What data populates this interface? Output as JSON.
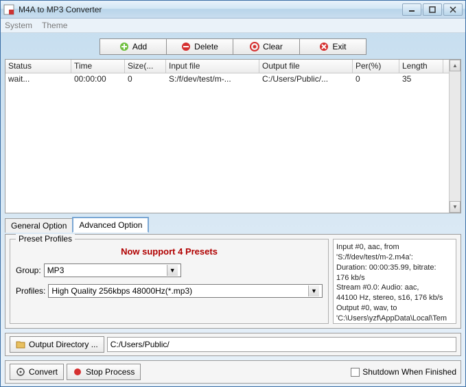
{
  "window": {
    "title": "M4A to MP3 Converter"
  },
  "menu": {
    "system": "System",
    "theme": "Theme"
  },
  "toolbar": {
    "add": "Add",
    "delete": "Delete",
    "clear": "Clear",
    "exit": "Exit"
  },
  "table": {
    "headers": {
      "status": "Status",
      "time": "Time",
      "size": "Size(...",
      "input": "Input file",
      "output": "Output file",
      "per": "Per(%)",
      "length": "Length"
    },
    "rows": [
      {
        "status": "wait...",
        "time": "00:00:00",
        "size": "0",
        "input": "S:/f/dev/test/m-...",
        "output": "C:/Users/Public/...",
        "per": "0",
        "length": "35"
      }
    ]
  },
  "tabs": {
    "general": "General Option",
    "advanced": "Advanced Option"
  },
  "presets": {
    "legend": "Preset Profiles",
    "message": "Now support 4 Presets",
    "group_label": "Group:",
    "group_value": "MP3",
    "profiles_label": "Profiles:",
    "profiles_value": "High Quality 256kbps 48000Hz(*.mp3)"
  },
  "info": {
    "l1": "Input #0, aac, from",
    "l2": "'S:/f/dev/test/m-2.m4a':",
    "l3": "  Duration: 00:00:35.99, bitrate:",
    "l4": "176 kb/s",
    "l5": "    Stream #0.0: Audio: aac,",
    "l6": "44100 Hz, stereo, s16, 176 kb/s",
    "l7": "Output #0, wav, to",
    "l8": "'C:\\Users\\yzf\\AppData\\Local\\Tem"
  },
  "outdir": {
    "button": "Output Directory ...",
    "value": "C:/Users/Public/"
  },
  "bottom": {
    "convert": "Convert",
    "stop": "Stop Process",
    "shutdown": "Shutdown When Finished"
  }
}
